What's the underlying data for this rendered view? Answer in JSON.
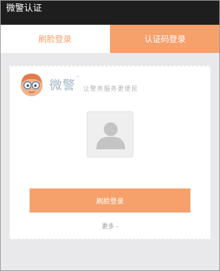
{
  "titlebar": {
    "title": "微警认证"
  },
  "tabs": [
    {
      "label": "刷脸登录",
      "active": false
    },
    {
      "label": "认证码登录",
      "active": true
    }
  ],
  "card": {
    "brand_name": "微警",
    "brand_mark": "™",
    "slogan": "让警务服务更便民",
    "avatar_icon": "user-placeholder-icon",
    "primary_button": "刷脸登录",
    "more_link": "更多 -"
  },
  "colors": {
    "accent": "#f6a06c",
    "titlebar": "#1e1e1e",
    "background": "#e9e9eb"
  }
}
